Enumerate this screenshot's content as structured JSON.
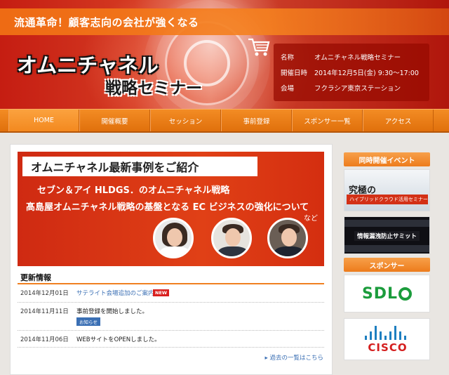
{
  "header": {
    "tagline": "流通革命！顧客志向の会社が強くなる",
    "logo_main": "オムニチャネル",
    "logo_sub": "戦略セミナー",
    "info": [
      {
        "label": "名称",
        "value": "オムニチャネル戦略セミナー"
      },
      {
        "label": "開催日時",
        "value": "2014年12月5日(金) 9:30～17:00"
      },
      {
        "label": "会場",
        "value": "フクラシア東京ステーション"
      }
    ]
  },
  "nav": {
    "items": [
      {
        "label": "HOME",
        "active": true
      },
      {
        "label": "開催概要",
        "active": false
      },
      {
        "label": "セッション",
        "active": false
      },
      {
        "label": "事前登録",
        "active": false
      },
      {
        "label": "スポンサー一覧",
        "active": false
      },
      {
        "label": "アクセス",
        "active": false
      }
    ]
  },
  "banner": {
    "title": "オムニチャネル最新事例をご紹介",
    "line1": "セブン＆アイ HLDGS．のオムニチャネル戦略",
    "line2": "髙島屋オムニチャネル戦略の基盤となる EC ビジネスの強化について",
    "etc": "など"
  },
  "news": {
    "heading": "更新情報",
    "items": [
      {
        "date": "2014年12月01日",
        "text": "サテライト会場追加のご案内",
        "badge": "NEW"
      },
      {
        "date": "2014年11月11日",
        "text": "事前登録を開始しました。",
        "badge": "お知らせ"
      },
      {
        "date": "2014年11月06日",
        "text": "WEBサイトをOPENしました。"
      }
    ],
    "more": "過去の一覧はこちら"
  },
  "sidebar": {
    "concurrent_heading": "同時開催イベント",
    "ad1_big": "究極の",
    "ad1_sub": "ハイブリッドクラウド活用セミナー",
    "ad2_text": "情報漏洩防止サミット",
    "sponsor_heading": "スポンサー",
    "sponsor1": "SDL",
    "sponsor2": "CISCO"
  },
  "colors": {
    "accent": "#ed7c1c",
    "header_red": "#c51d12",
    "link": "#3a6fb4"
  }
}
